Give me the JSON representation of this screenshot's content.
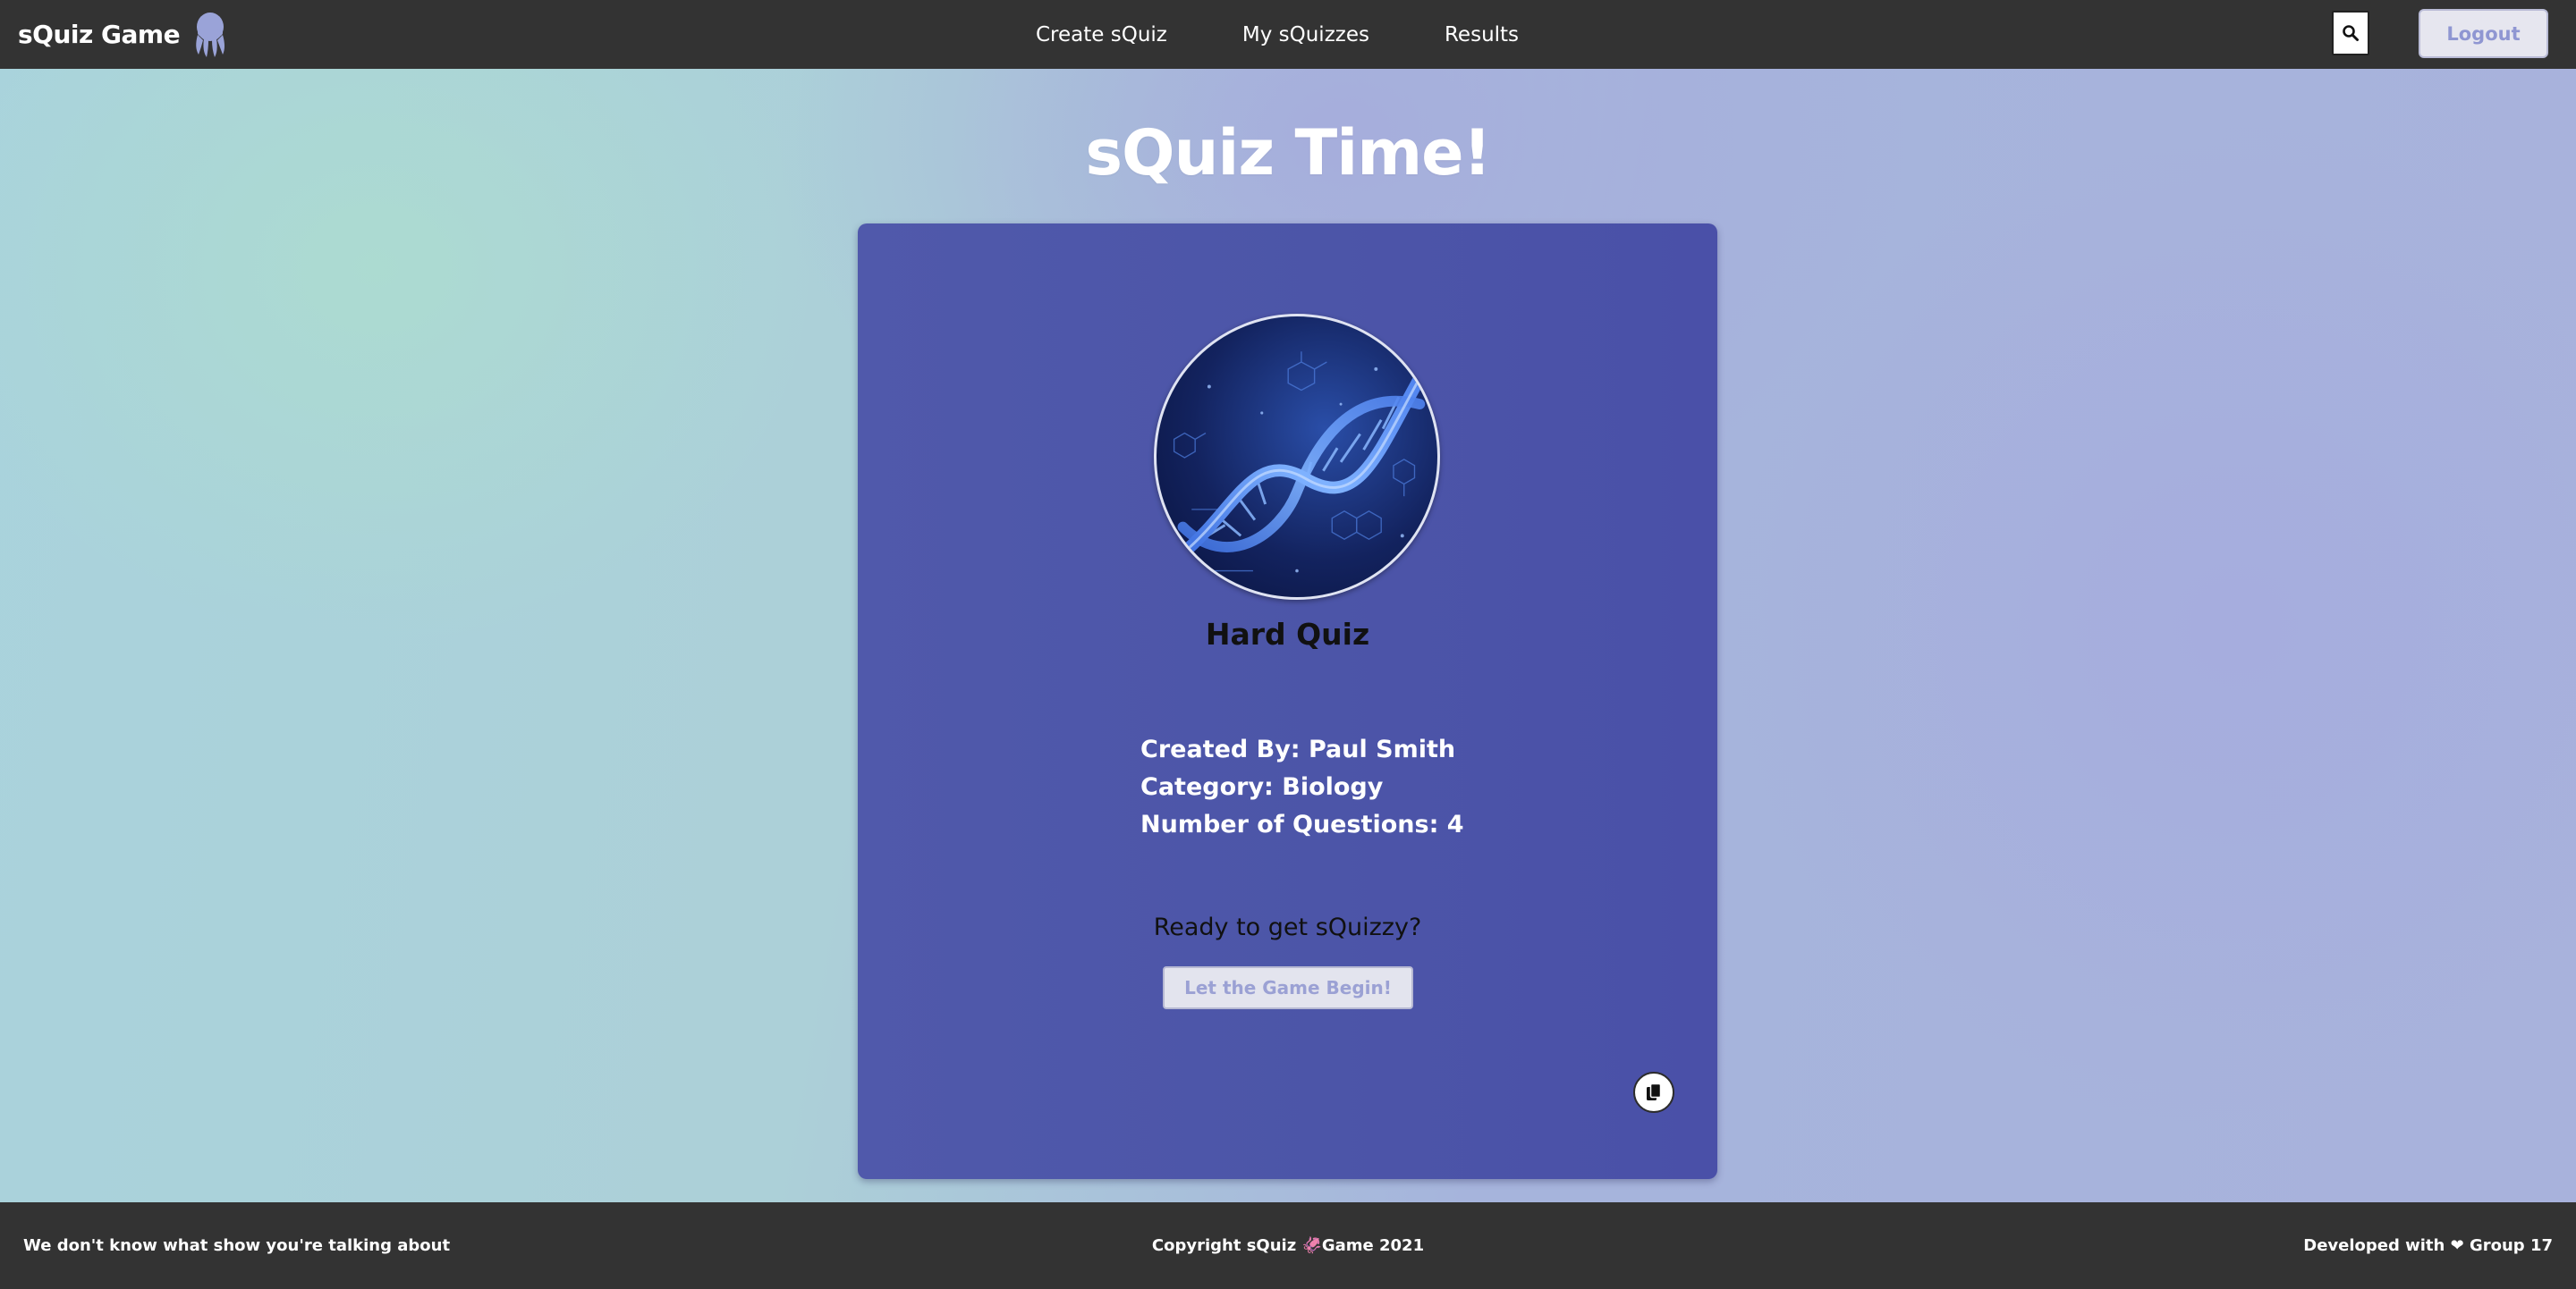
{
  "app": {
    "brand": "sQuiz Game",
    "logo_icon": "squid-logo-icon"
  },
  "nav": {
    "items": [
      {
        "label": "Create sQuiz"
      },
      {
        "label": "My sQuizzes"
      },
      {
        "label": "Results"
      }
    ],
    "search_icon": "search-icon",
    "logout_label": "Logout"
  },
  "main": {
    "title": "sQuiz Time!",
    "quiz": {
      "image_icon": "dna-helix-image",
      "name": "Hard Quiz",
      "created_by": "Created By: Paul Smith",
      "category": "Category: Biology",
      "question_count": "Number of Questions: 4"
    },
    "prompt": "Ready to get sQuizzy?",
    "start_button_label": "Let the Game Begin!",
    "copy_icon": "copy-icon"
  },
  "footer": {
    "left": "We don't know what show you're talking about",
    "center": "Copyright sQuiz 🦑Game 2021",
    "right": "Developed with ❤ Group 17"
  },
  "colors": {
    "topbar": "#333333",
    "card": "#4c55a8",
    "accent": "#8f96d2"
  }
}
